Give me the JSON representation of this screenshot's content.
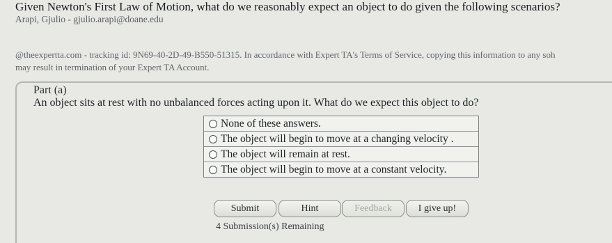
{
  "question": {
    "title": "Given Newton's First Law of Motion, what do we reasonably expect an object to do given the following scenarios?",
    "author": "Arapi, Gjulio - gjulio.arapi@doane.edu",
    "tracking_line1": "@theexpertta.com - tracking id: 9N69-40-2D-49-B550-51315. In accordance with Expert TA's Terms of Service, copying this information to any soh",
    "tracking_line2": "may result in termination of your Expert TA Account."
  },
  "part": {
    "label": "Part (a)",
    "text": "An object sits at rest with no unbalanced forces acting upon it. What do we expect this object to do?",
    "choices": [
      "None of these answers.",
      "The object will begin to move at a changing velocity .",
      "The object will remain at rest.",
      "The object will begin to move at a constant velocity."
    ]
  },
  "buttons": {
    "submit": "Submit",
    "hint": "Hint",
    "feedback": "Feedback",
    "give_up": "I give up!"
  },
  "status": {
    "remaining": "4 Submission(s) Remaining"
  }
}
